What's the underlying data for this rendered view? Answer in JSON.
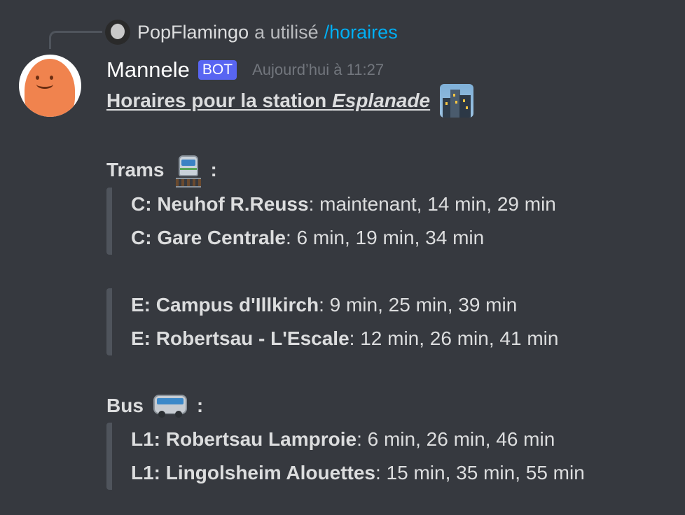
{
  "reply": {
    "user": "PopFlamingo",
    "verb": "a utilisé",
    "command": "/horaires"
  },
  "author": {
    "name": "Mannele",
    "tag": "BOT",
    "timestamp": "Aujourd’hui à 11:27"
  },
  "message": {
    "title_prefix": "Horaires pour la station ",
    "station": "Esplanade",
    "title_emoji": "cityscape-at-dusk-icon"
  },
  "sections": {
    "trams": {
      "heading": "Trams",
      "emoji": "light-rail-icon",
      "colon": ":",
      "group1": [
        {
          "route": "C: Neuhof R.Reuss",
          "times": ": maintenant, 14 min, 29 min"
        },
        {
          "route": "C: Gare Centrale",
          "times": ": 6 min, 19 min, 34 min"
        }
      ],
      "group2": [
        {
          "route": "E: Campus d'Illkirch",
          "times": ": 9 min, 25 min, 39 min"
        },
        {
          "route": "E: Robertsau - L'Escale",
          "times": ": 12 min, 26 min, 41 min"
        }
      ]
    },
    "bus": {
      "heading": "Bus",
      "emoji": "bus-icon",
      "colon": ":",
      "group1": [
        {
          "route": "L1: Robertsau Lamproie",
          "times": ": 6 min, 26 min, 46 min"
        },
        {
          "route": "L1: Lingolsheim Alouettes",
          "times": ": 15 min, 35 min, 55 min"
        }
      ]
    }
  },
  "colors": {
    "background": "#36393f",
    "text": "#dcddde",
    "link": "#00aff4",
    "bot_tag": "#5865f2",
    "timestamp": "#72767d",
    "quote_bar": "#4f545c"
  }
}
